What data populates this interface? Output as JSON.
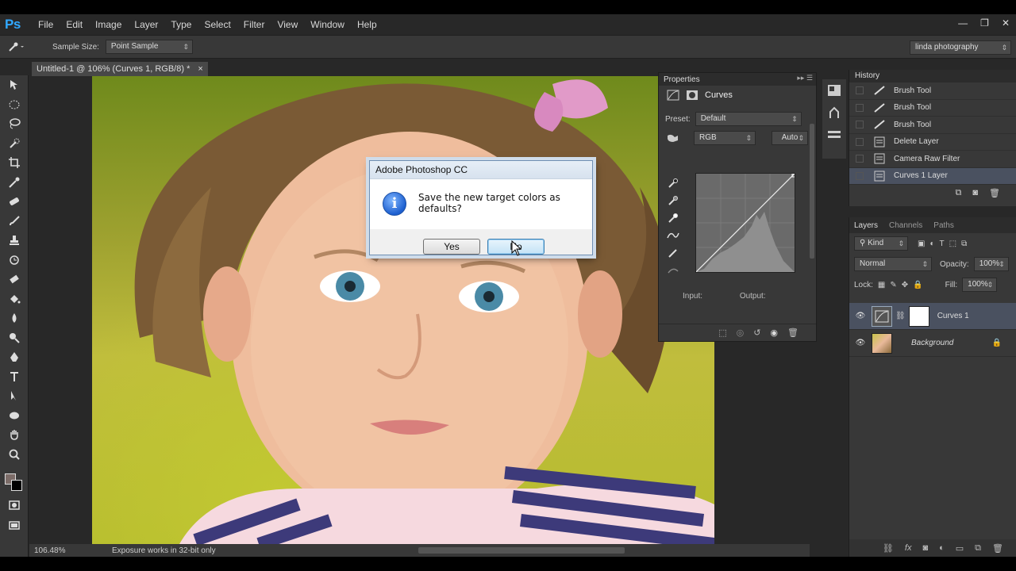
{
  "app": {
    "logo": "Ps",
    "menu": [
      "File",
      "Edit",
      "Image",
      "Layer",
      "Type",
      "Select",
      "Filter",
      "View",
      "Window",
      "Help"
    ],
    "window_controls": [
      "—",
      "❐",
      "✕"
    ]
  },
  "options_bar": {
    "sample_size_label": "Sample Size:",
    "sample_size_value": "Point Sample",
    "workspace": "linda photography"
  },
  "document": {
    "tab_title": "Untitled-1 @ 106% (Curves 1, RGB/8) *",
    "tab_close": "×",
    "zoom": "106.48%",
    "status_text": "Exposure works in 32-bit only"
  },
  "dialog": {
    "title": "Adobe Photoshop CC",
    "message": "Save the new target colors as defaults?",
    "yes_label": "Yes",
    "no_label": "No",
    "icon": "info-icon"
  },
  "properties": {
    "tab": "Properties",
    "title": "Curves",
    "preset_label": "Preset:",
    "preset_value": "Default",
    "channel": "RGB",
    "auto_label": "Auto",
    "input_label": "Input:",
    "output_label": "Output:"
  },
  "history": {
    "tab": "History",
    "items": [
      {
        "label": "Brush Tool",
        "icon": "brush-icon"
      },
      {
        "label": "Brush Tool",
        "icon": "brush-icon"
      },
      {
        "label": "Brush Tool",
        "icon": "brush-icon"
      },
      {
        "label": "Delete Layer",
        "icon": "document-icon"
      },
      {
        "label": "Camera Raw Filter",
        "icon": "document-icon"
      },
      {
        "label": "Curves 1 Layer",
        "icon": "document-icon",
        "active": true
      }
    ]
  },
  "layers": {
    "tabs": [
      "Layers",
      "Channels",
      "Paths"
    ],
    "filter_kind": "Kind",
    "blend_mode": "Normal",
    "opacity_label": "Opacity:",
    "opacity_value": "100%",
    "lock_label": "Lock:",
    "fill_label": "Fill:",
    "fill_value": "100%",
    "items": [
      {
        "name": "Curves 1",
        "active": true
      },
      {
        "name": "Background",
        "locked": true
      }
    ]
  },
  "colors": {
    "accent": "#31a8ff",
    "selection": "#4a5160",
    "panel": "#383838"
  }
}
